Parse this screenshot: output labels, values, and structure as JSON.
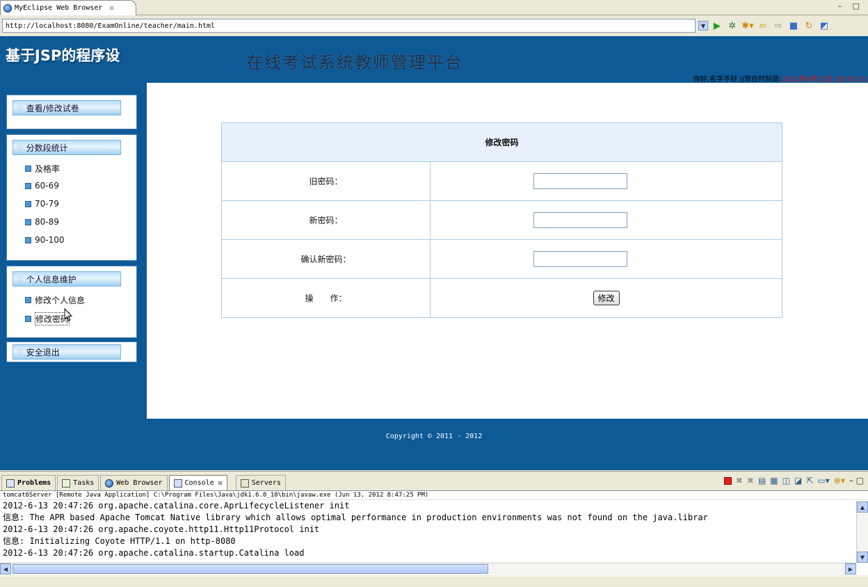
{
  "browser": {
    "tab_title": "MyEclipse Web Browser",
    "tab_close": "☒",
    "window_controls": "– □",
    "url": "http://localhost:8080/ExamOnline/teacher/main.html"
  },
  "header": {
    "logo_text": "基于JSP的程序设",
    "platform_title": "在线考试系统教师管理平台",
    "greeting": "你好,名字不好 ||现在时刻是:",
    "time": "2012年6月13日 20:50:31"
  },
  "sidebar": {
    "sections": [
      {
        "title": "查看/修改试卷",
        "items": []
      },
      {
        "title": "分数段统计",
        "items": [
          "及格率",
          "60-69",
          "70-79",
          "80-89",
          "90-100"
        ]
      },
      {
        "title": "个人信息维护",
        "items": [
          "修改个人信息",
          "修改密码"
        ]
      },
      {
        "title": "安全退出",
        "items": []
      }
    ]
  },
  "form": {
    "title": "修改密码",
    "old_password_label": "旧密码：",
    "new_password_label": "新密码：",
    "confirm_password_label": "确认新密码：",
    "operation_label": "操　　作：",
    "submit_label": "修改"
  },
  "footer": {
    "copyright": "Copyright © 2011 - 2012"
  },
  "panel": {
    "tabs": [
      {
        "label": "Problems",
        "bold": true
      },
      {
        "label": "Tasks"
      },
      {
        "label": "Web Browser"
      },
      {
        "label": "Console ☒",
        "active": true
      },
      {
        "label": "Servers"
      }
    ],
    "process_line": "tomcat6Server [Remote Java Application] C:\\Program Files\\Java\\jdk1.6.0_10\\bin\\javaw.exe (Jun 13, 2012 8:47:25 PM)",
    "log_lines": [
      "2012-6-13 20:47:26 org.apache.catalina.core.AprLifecycleListener init",
      "信息: The APR based Apache Tomcat Native library which allows optimal performance in production environments was not found on the java.librar",
      "2012-6-13 20:47:26 org.apache.coyote.http11.Http11Protocol init",
      "信息: Initializing Coyote HTTP/1.1 on http-8080",
      "2012-6-13 20:47:26 org.apache.catalina.startup.Catalina load"
    ]
  },
  "colors": {
    "page_blue": "#0d5a97",
    "time_red": "#dd1111",
    "form_header_bg": "#e6f1fb",
    "table_border": "#aacbe5"
  }
}
